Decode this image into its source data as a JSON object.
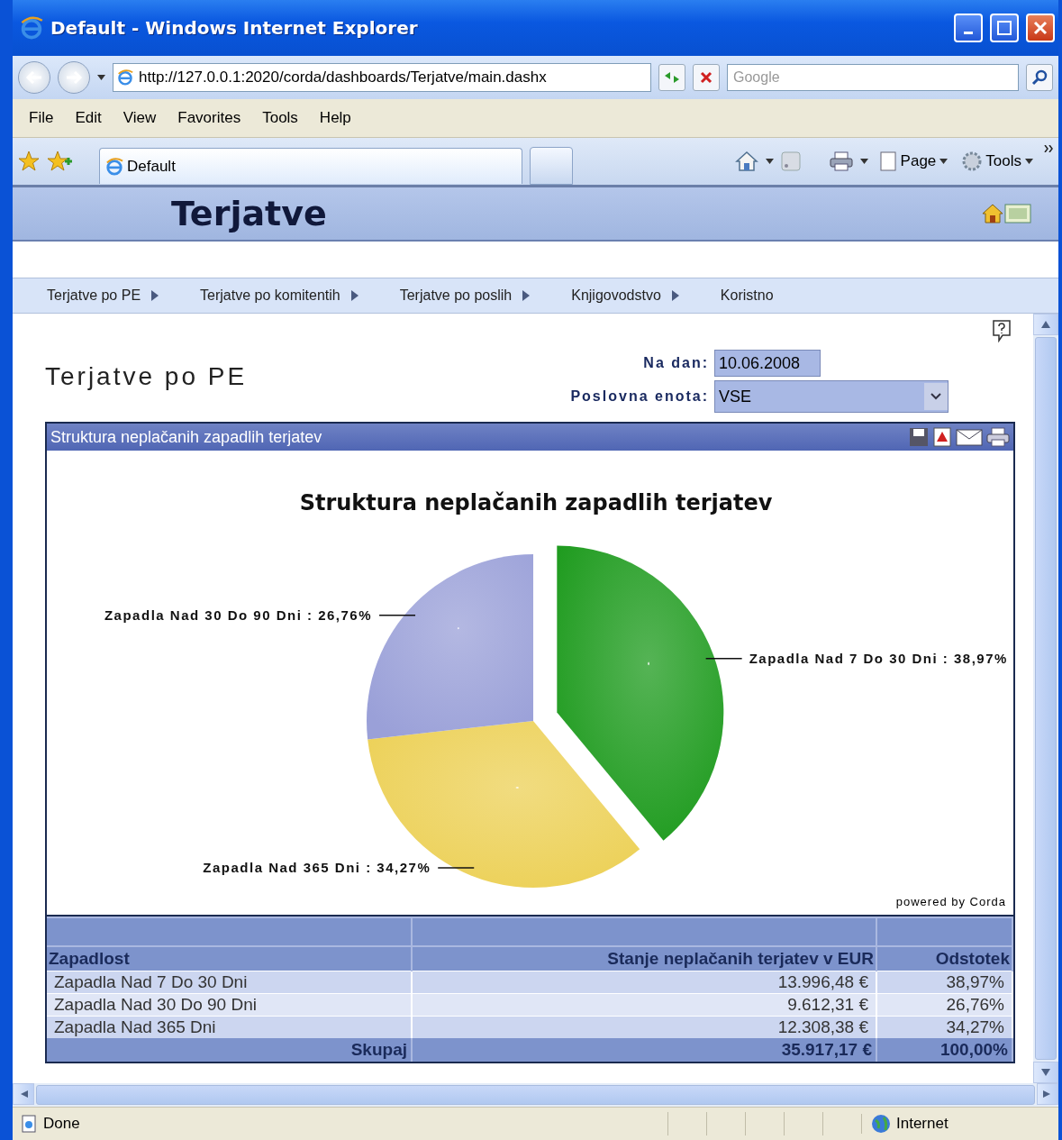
{
  "window": {
    "title": "Default - Windows Internet Explorer"
  },
  "address_bar": {
    "url": "http://127.0.0.1:2020/corda/dashboards/Terjatve/main.dashx"
  },
  "search": {
    "placeholder": "Google"
  },
  "menu": [
    "File",
    "Edit",
    "View",
    "Favorites",
    "Tools",
    "Help"
  ],
  "tabs": [
    {
      "label": "Default",
      "selected": true
    }
  ],
  "command_bar": [
    {
      "label": "Page"
    },
    {
      "label": "Tools"
    }
  ],
  "app": {
    "title": "Terjatve",
    "nav": [
      {
        "label": "Terjatve po PE",
        "has_submenu": true
      },
      {
        "label": "Terjatve po komitentih",
        "has_submenu": true
      },
      {
        "label": "Terjatve po poslih",
        "has_submenu": true
      },
      {
        "label": "Knjigovodstvo",
        "has_submenu": true
      },
      {
        "label": "Koristno",
        "has_submenu": false
      }
    ]
  },
  "page": {
    "heading": "Terjatve po PE",
    "filters": [
      {
        "label": "Na dan:",
        "value": "10.06.2008",
        "kind": "text"
      },
      {
        "label": "Poslovna enota:",
        "value": "VSE",
        "kind": "select"
      }
    ]
  },
  "panel": {
    "title": "Struktura neplačanih zapadlih terjatev",
    "credit": "powered by Corda",
    "chart_data": {
      "type": "pie",
      "title": "Struktura neplačanih zapadlih terjatev",
      "categories": [
        "Zapadla Nad 7 Do 30 Dni : 38,97%",
        "Zapadla Nad 365 Dni : 34,27%",
        "Zapadla Nad 30 Do 90 Dni : 26,76%"
      ],
      "values": [
        38.97,
        34.27,
        26.76
      ],
      "colors": [
        "#1c9a1c",
        "#ecd055",
        "#9aa0d8"
      ]
    },
    "slices": [
      {
        "exploded": true
      },
      {
        "exploded": false
      },
      {
        "exploded": false
      }
    ]
  },
  "table": {
    "columns": [
      "Zapadlost",
      "Stanje neplačanih terjatev v EUR",
      "Odstotek"
    ],
    "rows": [
      [
        "Zapadla Nad 7 Do 30 Dni",
        "13.996,48 €",
        "38,97%"
      ],
      [
        "Zapadla Nad 30 Do 90 Dni",
        "9.612,31 €",
        "26,76%"
      ],
      [
        "Zapadla Nad 365 Dni",
        "12.308,38 €",
        "34,27%"
      ]
    ],
    "total": [
      "Skupaj",
      "35.917,17 €",
      "100,00%"
    ]
  },
  "status_bar": {
    "text": "Done",
    "zone": "Internet"
  }
}
